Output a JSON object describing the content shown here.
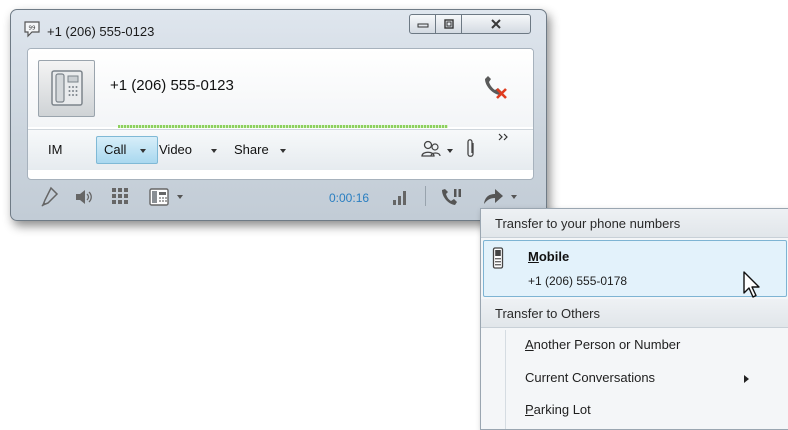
{
  "window": {
    "title": "+1 (206) 555-0123",
    "title_icon": "im-conversation-icon",
    "controls": [
      "minimize-icon",
      "restore-icon",
      "close-icon"
    ]
  },
  "contact": {
    "name": "+1 (206) 555-0123",
    "avatar_icon": "desk-phone-icon",
    "hangup_icon": "hang-up-icon"
  },
  "tabs": {
    "im": "IM",
    "call": "Call",
    "video": "Video",
    "share": "Share"
  },
  "toolbar": {
    "timer": "0:00:16"
  },
  "menu": {
    "header_phone": "Transfer to your phone numbers",
    "mobile_title_first": "M",
    "mobile_title_rest": "obile",
    "mobile_number": "+1 (206) 555-0178",
    "header_others": "Transfer to Others",
    "item_another_first": "A",
    "item_another_rest": "nother Person or Number",
    "item_current": "Current Conversations",
    "item_parking_first": "P",
    "item_parking_rest": "arking Lot"
  },
  "colors": {
    "accent": "#2a7fc1",
    "call_tab": "#a9d8ef",
    "selection": "#e3f2fb",
    "hangup_red": "#e03c1f"
  }
}
